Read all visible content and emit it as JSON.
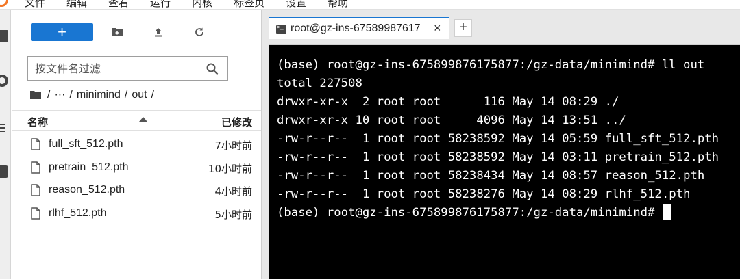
{
  "menu": {
    "items": [
      "文件",
      "编辑",
      "查看",
      "运行",
      "内核",
      "标签页",
      "设置",
      "帮助"
    ]
  },
  "toolbar": {
    "new_label": "+"
  },
  "filter": {
    "placeholder": "按文件名过滤"
  },
  "breadcrumb": {
    "root_sep": "/",
    "ellipsis": "···",
    "sep": "/",
    "folder1": "minimind",
    "folder2": "out",
    "tail": "/"
  },
  "file_table": {
    "col_name": "名称",
    "col_modified": "已修改",
    "files": [
      {
        "name": "full_sft_512.pth",
        "modified": "7小时前"
      },
      {
        "name": "pretrain_512.pth",
        "modified": "10小时前"
      },
      {
        "name": "reason_512.pth",
        "modified": "4小时前"
      },
      {
        "name": "rlhf_512.pth",
        "modified": "5小时前"
      }
    ]
  },
  "terminal_tab": {
    "title": "root@gz-ins-67589987617",
    "close": "×",
    "add": "+"
  },
  "terminal": {
    "lines": [
      "(base) root@gz-ins-675899876175877:/gz-data/minimind# ll out",
      "total 227508",
      "drwxr-xr-x  2 root root      116 May 14 08:29 ./",
      "drwxr-xr-x 10 root root     4096 May 14 13:51 ../",
      "-rw-r--r--  1 root root 58238592 May 14 05:59 full_sft_512.pth",
      "-rw-r--r--  1 root root 58238592 May 14 03:11 pretrain_512.pth",
      "-rw-r--r--  1 root root 58238434 May 14 08:57 reason_512.pth",
      "-rw-r--r--  1 root root 58238276 May 14 08:29 rlhf_512.pth"
    ],
    "prompt": "(base) root@gz-ins-675899876175877:/gz-data/minimind# "
  },
  "colors": {
    "accent": "#1976d2",
    "terminal_bg": "#000000",
    "terminal_fg": "#ffffff",
    "link_dir": "#4aa8ff"
  }
}
